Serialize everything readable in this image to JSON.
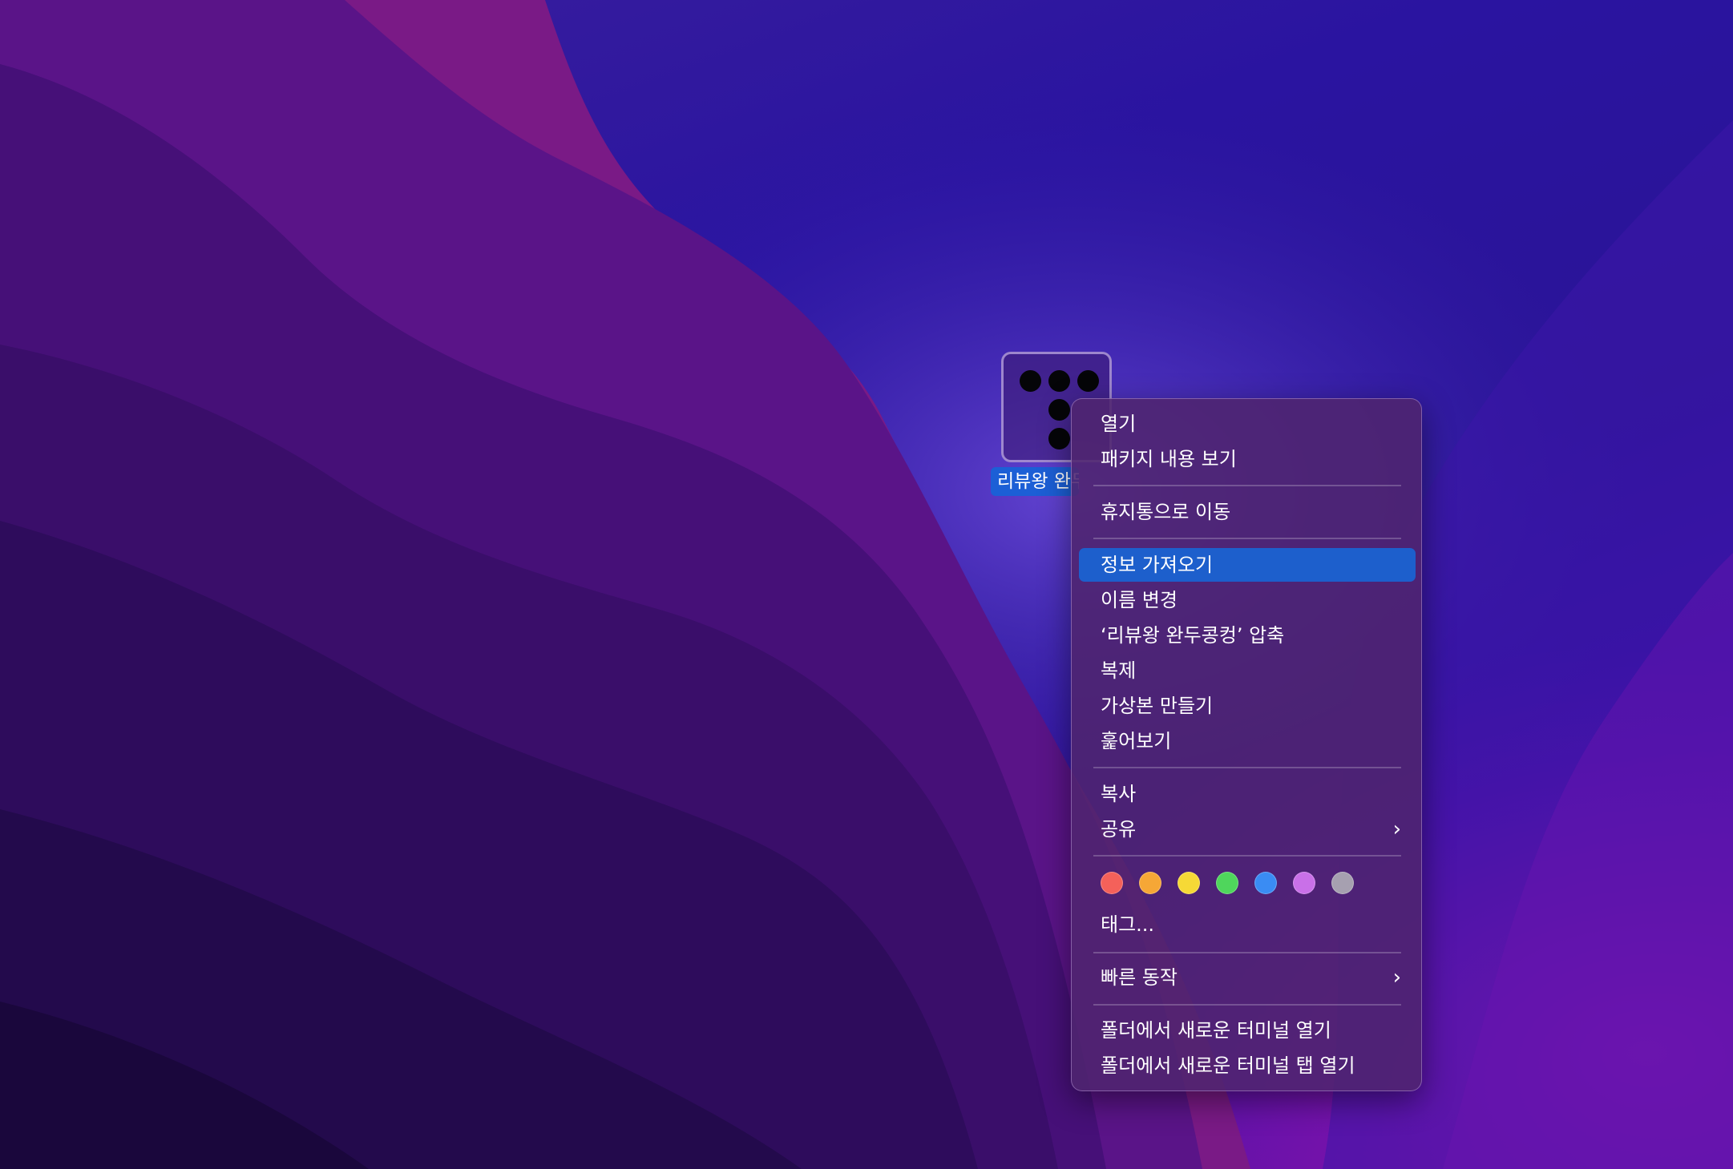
{
  "desktop": {
    "icon_label": "리뷰왕 완두콩컹"
  },
  "menu": {
    "items": [
      {
        "label": "열기"
      },
      {
        "label": "패키지 내용 보기"
      },
      {
        "label": "휴지통으로 이동"
      },
      {
        "label": "정보 가져오기"
      },
      {
        "label": "이름 변경"
      },
      {
        "label": "‘리뷰왕 완두콩컹’ 압축"
      },
      {
        "label": "복제"
      },
      {
        "label": "가상본 만들기"
      },
      {
        "label": "훑어보기"
      },
      {
        "label": "복사"
      },
      {
        "label": "공유"
      },
      {
        "label": "태그..."
      },
      {
        "label": "빠른 동작"
      },
      {
        "label": "폴더에서 새로운 터미널 열기"
      },
      {
        "label": "폴더에서 새로운 터미널 탭 열기"
      }
    ],
    "highlighted_item": "정보 가져오기",
    "submenu_chevron": "›",
    "tag_colors": [
      {
        "name": "red",
        "hex": "#f4615a"
      },
      {
        "name": "orange",
        "hex": "#f6a736"
      },
      {
        "name": "yellow",
        "hex": "#f6d936"
      },
      {
        "name": "green",
        "hex": "#4fd65c"
      },
      {
        "name": "blue",
        "hex": "#3a8cf3"
      },
      {
        "name": "purple",
        "hex": "#c970e8"
      },
      {
        "name": "gray",
        "hex": "#a6a0b0"
      }
    ]
  }
}
